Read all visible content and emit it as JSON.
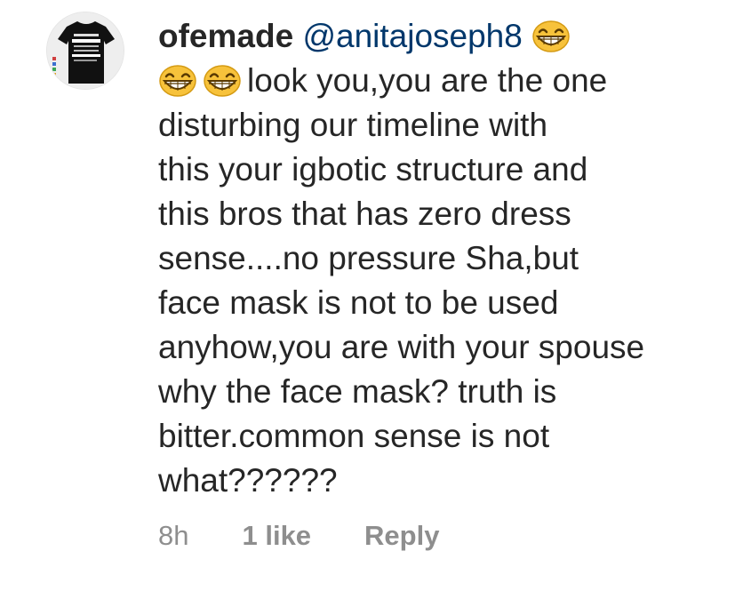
{
  "comment": {
    "username": "ofemade",
    "mention": "@anitajoseph8",
    "text_line1": "look you,you are the one",
    "text_rest": "disturbing our timeline with\nthis your igbotic structure and\nthis bros that has zero dress\nsense....no pressure Sha,but\nface mask is not to  be used\nanyhow,you are with your spouse\nwhy the face mask? truth is\nbitter.common sense is not\nwhat??????",
    "emoji_icon": "grinning-face-emoji",
    "avatar_icon": "profile-avatar-tshirt",
    "avatar_text": "I CAN EXPLAIN IT TO YOU BUT I CAN'T UNDERSTAND IT FOR YOU"
  },
  "meta": {
    "time": "8h",
    "likes": "1 like",
    "reply_label": "Reply"
  },
  "colors": {
    "text": "#262626",
    "mention": "#00376b",
    "secondary": "#8e8e8e",
    "emoji_face": "#f7c23b"
  }
}
